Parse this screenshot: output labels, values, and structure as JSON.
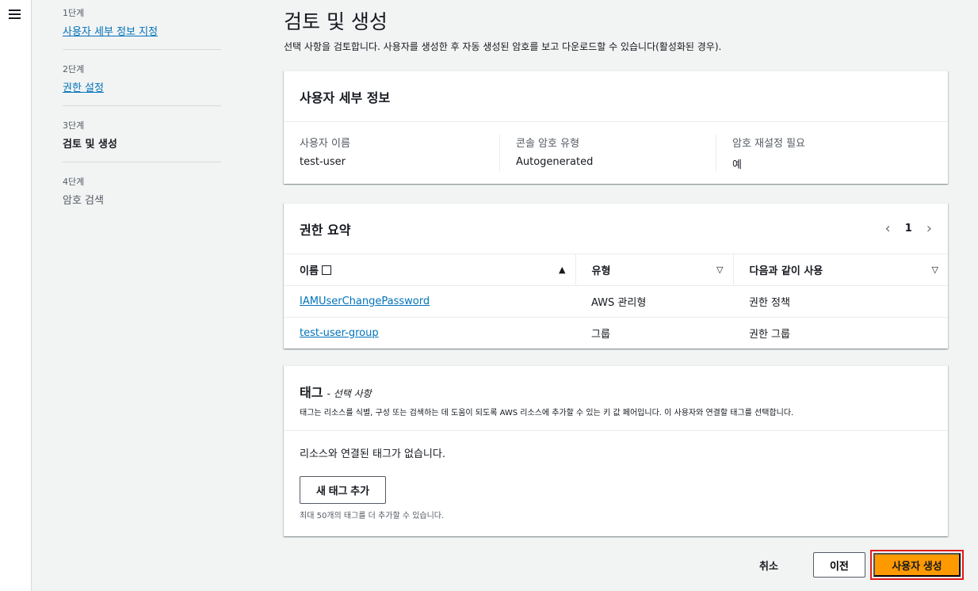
{
  "steps": [
    {
      "num": "1단계",
      "label": "사용자 세부 정보 지정"
    },
    {
      "num": "2단계",
      "label": "권한 설정"
    },
    {
      "num": "3단계",
      "label": "검토 및 생성"
    },
    {
      "num": "4단계",
      "label": "암호 검색"
    }
  ],
  "page": {
    "title": "검토 및 생성",
    "description": "선택 사항을 검토합니다. 사용자를 생성한 후 자동 생성된 암호를 보고 다운로드할 수 있습니다(활성화된 경우)."
  },
  "user_details": {
    "title": "사용자 세부 정보",
    "fields": [
      {
        "key": "사용자 이름",
        "value": "test-user"
      },
      {
        "key": "콘솔 암호 유형",
        "value": "Autogenerated"
      },
      {
        "key": "암호 재설정 필요",
        "value": "예"
      }
    ]
  },
  "permissions": {
    "title": "권한 요약",
    "page": "1",
    "columns": [
      "이름",
      "유형",
      "다음과 같이 사용"
    ],
    "rows": [
      {
        "name": "IAMUserChangePassword",
        "type": "AWS 관리형",
        "used_as": "권한 정책"
      },
      {
        "name": "test-user-group",
        "type": "그룹",
        "used_as": "권한 그룹"
      }
    ]
  },
  "tags": {
    "title": "태그",
    "optional": "- 선택 사항",
    "description": "태그는 리소스를 식별, 구성 또는 검색하는 데 도움이 되도록 AWS 리소스에 추가할 수 있는 키 값 페어입니다. 이 사용자와 연결할 태그를 선택합니다.",
    "empty": "리소스와 연결된 태그가 없습니다.",
    "add_button": "새 태그 추가",
    "hint": "최대 50개의 태그를 더 추가할 수 있습니다."
  },
  "actions": {
    "cancel": "취소",
    "previous": "이전",
    "create": "사용자 생성"
  },
  "colors": {
    "primary": "#ff9900",
    "link": "#0073bb",
    "highlight_border": "#e01b1b"
  }
}
